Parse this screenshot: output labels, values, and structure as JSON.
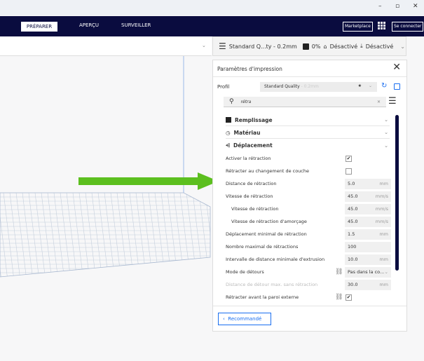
{
  "window": {
    "minimize": "–",
    "maximize": "▫",
    "close": "✕"
  },
  "nav": {
    "tabs": [
      "PRÉPARER",
      "APERÇU",
      "SURVEILLER"
    ],
    "marketplace": "Marketplace",
    "login": "Se connecter"
  },
  "toolbar": {
    "profile": "Standard Q...ty - 0.2mm",
    "infill": "0%",
    "support": "Désactivé",
    "adhesion": "Désactivé"
  },
  "panel": {
    "title": "Paramètres d'impression",
    "profile_label": "Profil",
    "profile_value": "Standard Quality",
    "profile_suffix": "- 0.2mm",
    "search_value": "rétra",
    "categories": [
      "Remplissage",
      "Matériau",
      "Déplacement"
    ],
    "settings": [
      {
        "label": "Activer la rétraction",
        "type": "check",
        "checked": true
      },
      {
        "label": "Rétracter au changement de couche",
        "type": "check",
        "checked": false
      },
      {
        "label": "Distance de rétraction",
        "value": "5.0",
        "unit": "mm"
      },
      {
        "label": "Vitesse de rétraction",
        "value": "45.0",
        "unit": "mm/s"
      },
      {
        "label": "Vitesse de rétraction",
        "value": "45.0",
        "unit": "mm/s",
        "indent": true
      },
      {
        "label": "Vitesse de rétraction d'amorçage",
        "value": "45.0",
        "unit": "mm/s",
        "indent": true
      },
      {
        "label": "Déplacement minimal de rétraction",
        "value": "1.5",
        "unit": "mm"
      },
      {
        "label": "Nombre maximal de rétractions",
        "value": "100",
        "unit": ""
      },
      {
        "label": "Intervalle de distance minimale d'extrusion",
        "value": "10.0",
        "unit": "mm"
      },
      {
        "label": "Mode de détours",
        "value": "Pas dans la co...",
        "unit": "⌄",
        "link": true
      },
      {
        "label": "Distance de détour max. sans rétraction",
        "value": "30.0",
        "unit": "mm",
        "disabled": true
      },
      {
        "label": "Rétracter avant la paroi externe",
        "type": "check",
        "checked": true,
        "link": true
      }
    ],
    "recommended": "Recommandé"
  },
  "colors": {
    "navy": "#0a0c3f",
    "arrow": "#5cbf1f",
    "accent": "#196ef0"
  }
}
